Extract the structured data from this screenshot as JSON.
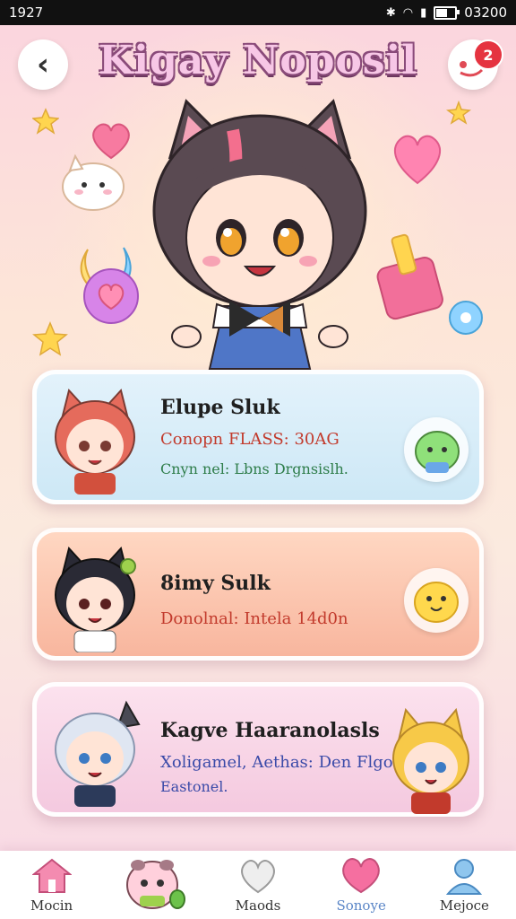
{
  "status_bar": {
    "time": "1927",
    "right_text": "03200"
  },
  "header": {
    "title": "Kigay Noposil",
    "notification_count": "2"
  },
  "cards": [
    {
      "title": "Elupe Sluk",
      "subtitle": "Conopn FLASS: 30AG",
      "note": "Cnyn nel: Lbns Drgnsislh."
    },
    {
      "title": "8imy Sulk",
      "subtitle": "Donolnal: Intela 14d0n"
    },
    {
      "title": "Kagve Haaranolasls",
      "subtitle": "Xoligamel, Aethas: Den Flgoon",
      "note": "Eastonel."
    }
  ],
  "bottom_nav": [
    {
      "label": "Mocin",
      "icon": "home-icon"
    },
    {
      "label": "",
      "icon": "pet-icon"
    },
    {
      "label": "Maods",
      "icon": "heart-outline-icon"
    },
    {
      "label": "Sonoye",
      "icon": "heart-icon",
      "active": true
    },
    {
      "label": "Mejoce",
      "icon": "user-icon"
    }
  ],
  "colors": {
    "card_blue": "#cde8f6",
    "card_peach": "#f8b69e",
    "card_pink": "#f4c9df",
    "subtitle_red": "#c23a2c",
    "active_blue": "#5b86c7",
    "badge_red": "#e53340"
  }
}
